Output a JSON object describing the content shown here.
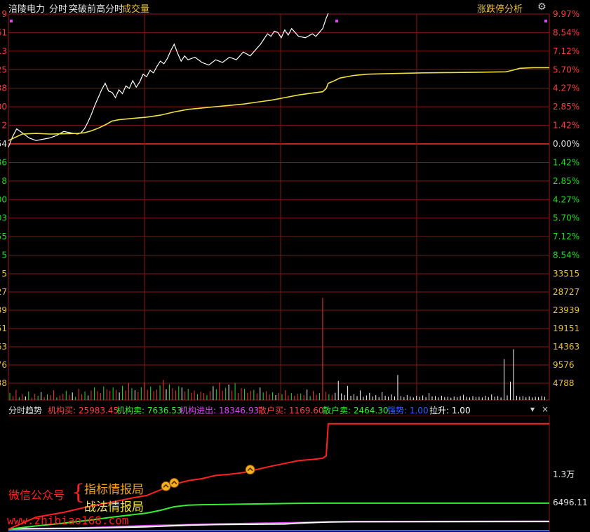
{
  "header": {
    "stock_name": "涪陵电力",
    "view_label": "分时",
    "indicator_name": "突破前高分时",
    "volume_label": "成交量",
    "right_button": "涨跌停分析"
  },
  "price_panel": {
    "left_cut_labels": [
      "9",
      "61",
      "13",
      "25",
      "38",
      "00",
      "2",
      "54",
      "36",
      "8",
      "00",
      "03",
      "55",
      "5"
    ],
    "right_pct_labels": [
      "9.97%",
      "8.54%",
      "7.12%",
      "5.70%",
      "4.27%",
      "2.85%",
      "1.42%",
      "0.00%",
      "1.42%",
      "2.85%",
      "4.27%",
      "5.70%",
      "7.12%",
      "8.54%"
    ],
    "upper_color": "#ff3c3c",
    "zero_color": "#e0e0e0",
    "lower_color": "#22dd22"
  },
  "volume_panel": {
    "right_labels": [
      "33515",
      "28727",
      "23939",
      "19151",
      "14363",
      "9576",
      "4788"
    ],
    "left_cut_labels": [
      "5",
      "27",
      "39",
      "51",
      "63",
      "76",
      "38"
    ],
    "label_color": "#e8c23a"
  },
  "indicator_panel": {
    "title": "分时趋势",
    "items": [
      {
        "label": "机构买: 25983.45",
        "color": "#ff4040"
      },
      {
        "label": "机构卖: 7636.53",
        "color": "#33ee33"
      },
      {
        "label": "机构进出: 18346.93",
        "color": "#e040fb"
      },
      {
        "label": "散户买: 1169.60",
        "color": "#ff4040"
      },
      {
        "label": "散户卖: 2464.30",
        "color": "#33ee33"
      },
      {
        "label": "强势: 1.00",
        "color": "#3060ff"
      },
      {
        "label": "拉升: 1.00",
        "color": "#ffffff"
      }
    ],
    "right_labels": [
      "1.3万",
      "6496.11"
    ]
  },
  "watermark": {
    "left_text": "微信公众号",
    "brace": "{",
    "line1": "指标情报局",
    "line2": "战法情报局",
    "url": "www.zhibiao168.com"
  },
  "chart_data": {
    "type": "line",
    "y_axis": "percent change",
    "ylim": [
      -9.97,
      9.97
    ],
    "series": [
      {
        "name": "",
        "color": "#ffffff",
        "x": [
          0,
          6,
          12,
          20,
          30,
          40,
          50,
          60,
          70,
          80,
          90,
          100,
          105,
          110,
          115,
          120,
          125,
          130,
          135,
          140,
          145,
          150,
          155,
          160,
          165,
          170,
          175,
          180,
          185,
          190,
          195,
          200,
          205,
          210,
          215,
          220,
          225,
          230,
          235,
          240,
          245,
          250,
          255,
          260,
          270,
          280,
          290,
          300,
          310,
          320,
          330,
          340,
          350,
          360,
          365,
          370,
          375,
          380,
          385,
          390,
          395,
          400,
          405,
          410,
          420,
          430,
          440,
          445,
          450,
          455,
          460,
          463
        ],
        "y": [
          -0.3,
          0.5,
          1.1,
          0.8,
          0.4,
          0.2,
          0.3,
          0.4,
          0.6,
          0.9,
          0.8,
          0.7,
          0.8,
          1.1,
          1.6,
          2.2,
          2.9,
          3.5,
          4.1,
          4.6,
          4.0,
          3.9,
          3.5,
          4.1,
          3.8,
          4.4,
          4.2,
          4.8,
          4.3,
          4.7,
          5.3,
          5.1,
          5.6,
          5.4,
          5.9,
          6.3,
          6.1,
          6.5,
          7.1,
          7.6,
          6.9,
          6.3,
          6.7,
          6.4,
          6.6,
          6.2,
          6.0,
          6.4,
          6.2,
          6.6,
          6.4,
          7.0,
          6.7,
          7.3,
          7.6,
          8.0,
          8.4,
          8.2,
          8.6,
          8.5,
          8.1,
          8.7,
          8.3,
          8.8,
          8.2,
          8.1,
          8.4,
          8.2,
          8.5,
          8.8,
          9.6,
          9.97
        ]
      },
      {
        "name": "",
        "color": "#f0e040",
        "x": [
          0,
          20,
          40,
          60,
          80,
          100,
          110,
          120,
          130,
          140,
          150,
          160,
          180,
          200,
          220,
          240,
          260,
          280,
          300,
          320,
          340,
          360,
          380,
          400,
          420,
          440,
          455,
          460,
          463,
          470,
          480,
          500,
          520,
          560,
          600,
          640,
          680,
          720,
          730,
          740,
          760,
          783
        ],
        "y": [
          0.2,
          0.7,
          0.75,
          0.7,
          0.72,
          0.75,
          0.8,
          0.95,
          1.15,
          1.4,
          1.7,
          1.8,
          1.9,
          2.0,
          2.15,
          2.4,
          2.6,
          2.7,
          2.8,
          2.9,
          3.0,
          3.15,
          3.3,
          3.5,
          3.7,
          3.85,
          3.95,
          4.2,
          4.6,
          4.75,
          5.0,
          5.2,
          5.3,
          5.35,
          5.4,
          5.42,
          5.45,
          5.48,
          5.6,
          5.75,
          5.8,
          5.8
        ]
      }
    ]
  },
  "volume_data": {
    "ymax": 38303,
    "values": [
      2200,
      1200,
      3100,
      900,
      1800,
      1100,
      2600,
      700,
      1900,
      1300,
      2400,
      900,
      1700,
      1500,
      3000,
      800,
      1400,
      1900,
      2800,
      1600,
      2300,
      1000,
      3400,
      1800,
      2600,
      1400,
      2900,
      3800,
      2700,
      2100,
      4100,
      3300,
      2800,
      3800,
      3100,
      2300,
      4300,
      2900,
      5200,
      3600,
      3000,
      2500,
      3900,
      5400,
      3100,
      4100,
      2700,
      3200,
      4500,
      6100,
      3300,
      4800,
      3600,
      2900,
      4200,
      3800,
      2600,
      3400,
      2200,
      2900,
      1800,
      2500,
      2100,
      1500,
      2700,
      4200,
      3300,
      5300,
      2800,
      3700,
      4700,
      2900,
      5100,
      2100,
      3600,
      3400,
      2200,
      2800,
      3100,
      2000,
      3800,
      2300,
      2700,
      1700,
      2400,
      1500,
      2200,
      1800,
      3000,
      1400,
      2100,
      1300,
      1900,
      2000,
      1500,
      3200,
      1200,
      2800,
      1600,
      2100,
      31000,
      2500,
      1800,
      1600,
      2200,
      5800,
      2000,
      1500,
      4300,
      1300,
      1800,
      1200,
      2900,
      1000,
      1400,
      2200,
      1100,
      1500,
      900,
      2400,
      1300,
      1000,
      1700,
      1100,
      7600,
      1200,
      900,
      1500,
      1100,
      800,
      1300,
      1000,
      1400,
      900,
      2100,
      1100,
      1200,
      800,
      1300,
      900,
      1000,
      700,
      1100,
      900,
      1200,
      1600,
      1000,
      800,
      1200,
      900,
      1000,
      800,
      1300,
      900,
      1700,
      1000,
      1200,
      800,
      12400,
      1400,
      5600,
      15400,
      1300,
      1000,
      1200,
      900,
      1100,
      800,
      1000,
      900,
      1200,
      1000
    ],
    "colors_note": "red=up, green=down, white=neutral"
  },
  "indicator_data": {
    "red": {
      "x": [
        0,
        40,
        80,
        100,
        110,
        140,
        180,
        200,
        220,
        240,
        260,
        280,
        300,
        320,
        340,
        360,
        380,
        400,
        420,
        440,
        455,
        460,
        463,
        783
      ],
      "y": [
        0,
        3000,
        4200,
        5000,
        5400,
        6400,
        7800,
        8400,
        9800,
        11200,
        12100,
        12600,
        13400,
        13700,
        14100,
        14900,
        15700,
        16400,
        17100,
        17400,
        17700,
        18300,
        26300,
        26300
      ]
    },
    "green": {
      "x": [
        0,
        40,
        80,
        120,
        150,
        180,
        200,
        220,
        240,
        260,
        280,
        300,
        320,
        340,
        360,
        380,
        400,
        420,
        440,
        460,
        500,
        600,
        783
      ],
      "y": [
        0,
        800,
        1500,
        2300,
        3000,
        3600,
        4000,
        4700,
        5600,
        6000,
        6100,
        6150,
        6200,
        6250,
        6300,
        6350,
        6400,
        6450,
        6480,
        6496,
        6496,
        6496,
        6496
      ]
    },
    "magenta": {
      "x": [
        0,
        100,
        200,
        300,
        400,
        463,
        500,
        783
      ],
      "y": [
        80,
        300,
        900,
        1300,
        1600,
        1800,
        1900,
        2000
      ]
    },
    "white": {
      "x": [
        0,
        100,
        200,
        260,
        300,
        400,
        420,
        463,
        500,
        783
      ],
      "y": [
        50,
        200,
        600,
        1000,
        1150,
        1300,
        1500,
        1800,
        1850,
        1900
      ]
    },
    "ylim": [
      0,
      28000
    ],
    "markers_x": [
      228,
      240,
      350
    ]
  }
}
